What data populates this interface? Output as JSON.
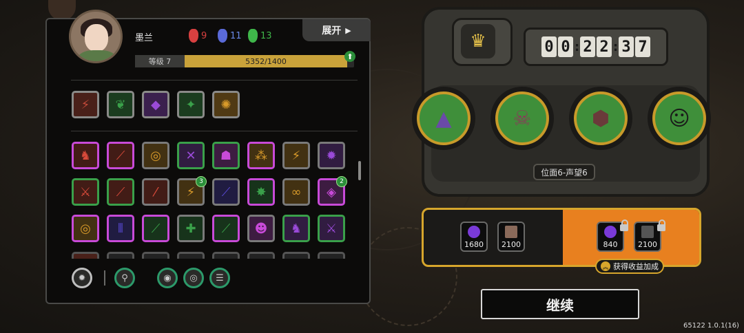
{
  "player": {
    "name": "墨兰",
    "level_label": "等级 7",
    "exp": "5352/1400",
    "exp_fraction": 0.94
  },
  "resources": [
    {
      "count": "9",
      "color": "#d84040",
      "icon": "red-mask-icon"
    },
    {
      "count": "11",
      "color": "#5a6ad8",
      "icon": "blue-mask-icon"
    },
    {
      "count": "13",
      "color": "#3fb64a",
      "icon": "green-mask-icon"
    }
  ],
  "expand_label": "展开",
  "expand_arrow": "▶",
  "level_up_arrow": "⬆",
  "equipped_skills": [
    {
      "glyph": "⚡",
      "color": "#c44a3a"
    },
    {
      "glyph": "❦",
      "color": "#3aa04a"
    },
    {
      "glyph": "◆",
      "color": "#9a4ad8"
    },
    {
      "glyph": "✦",
      "color": "#3aa04a"
    },
    {
      "glyph": "✺",
      "color": "#d89a2a"
    }
  ],
  "skill_grid": [
    {
      "glyph": "♞",
      "color": "#d84a3a",
      "border": "#c84ad8"
    },
    {
      "glyph": "⟋",
      "color": "#d84a3a",
      "border": "#c84ad8"
    },
    {
      "glyph": "◎",
      "color": "#d89a2a",
      "border": "#7a7a7a"
    },
    {
      "glyph": "✕",
      "color": "#9a4ad8",
      "border": "#3aa04a"
    },
    {
      "glyph": "☗",
      "color": "#c84ad8",
      "border": "#3aa04a"
    },
    {
      "glyph": "⁂",
      "color": "#d89a2a",
      "border": "#c84ad8"
    },
    {
      "glyph": "⚡",
      "color": "#d89a2a",
      "border": "#7a7a7a"
    },
    {
      "glyph": "✹",
      "color": "#9a4ad8",
      "border": "#7a7a7a"
    },
    {
      "glyph": "⚔",
      "color": "#d84a3a",
      "border": "#3aa04a"
    },
    {
      "glyph": "⟋",
      "color": "#d84a3a",
      "border": "#3aa04a"
    },
    {
      "glyph": "⁄",
      "color": "#d84a3a",
      "border": "#7a7a7a"
    },
    {
      "glyph": "⚡",
      "color": "#d89a2a",
      "border": "#7a7a7a",
      "badge": "3"
    },
    {
      "glyph": "⟋",
      "color": "#5a4ad8",
      "border": "#7a7a7a"
    },
    {
      "glyph": "✸",
      "color": "#3aa04a",
      "border": "#c84ad8"
    },
    {
      "glyph": "∞",
      "color": "#d89a2a",
      "border": "#7a7a7a"
    },
    {
      "glyph": "◈",
      "color": "#c84ad8",
      "border": "#c84ad8",
      "badge": "2"
    },
    {
      "glyph": "◎",
      "color": "#d89a2a",
      "border": "#c84ad8"
    },
    {
      "glyph": "⦀",
      "color": "#5a4ad8",
      "border": "#c84ad8"
    },
    {
      "glyph": "⟋",
      "color": "#3aa04a",
      "border": "#c84ad8"
    },
    {
      "glyph": "✚",
      "color": "#3aa04a",
      "border": "#7a7a7a"
    },
    {
      "glyph": "⟋",
      "color": "#3aa04a",
      "border": "#c84ad8"
    },
    {
      "glyph": "☻",
      "color": "#c84ad8",
      "border": "#7a7a7a"
    },
    {
      "glyph": "♞",
      "color": "#9a4ad8",
      "border": "#3aa04a"
    },
    {
      "glyph": "⚔",
      "color": "#9a4ad8",
      "border": "#3aa04a"
    }
  ],
  "bottom_slots": [
    {
      "glyph": "✹",
      "color": "#2c9a6a"
    },
    {
      "glyph": "⚲",
      "color": "#2c9a6a"
    },
    {
      "glyph": "◉",
      "color": "#2c9a6a"
    },
    {
      "glyph": "◎",
      "color": "#2c9a6a"
    },
    {
      "glyph": "☰",
      "color": "#2c9a6a"
    }
  ],
  "timer": {
    "digits": [
      "0",
      "0",
      "2",
      "2",
      "3",
      "7"
    ]
  },
  "crown_glyph": "♛",
  "enemies": [
    {
      "glyph": "▲",
      "bg": "#3f8f3a",
      "fg": "#6a4aa8"
    },
    {
      "glyph": "☠",
      "bg": "#3f8f3a",
      "fg": "#8a3a5a"
    },
    {
      "glyph": "⬢",
      "bg": "#3f8f3a",
      "fg": "#6a3a3a"
    },
    {
      "glyph": "☺",
      "bg": "#3f8f3a",
      "fg": "#1a1a1a"
    }
  ],
  "stage_label": "位面6-声望6",
  "rewards_base": [
    {
      "value": "1680",
      "color": "#7a3ad8"
    },
    {
      "value": "2100",
      "color": "#8a6a5a"
    }
  ],
  "rewards_bonus": [
    {
      "value": "840",
      "color": "#7a3ad8"
    },
    {
      "value": "2100",
      "color": "#555"
    }
  ],
  "bonus_label": "获得收益加成",
  "bonus_chevron": "︽",
  "continue_label": "继续",
  "version": "65122 1.0.1(16)"
}
